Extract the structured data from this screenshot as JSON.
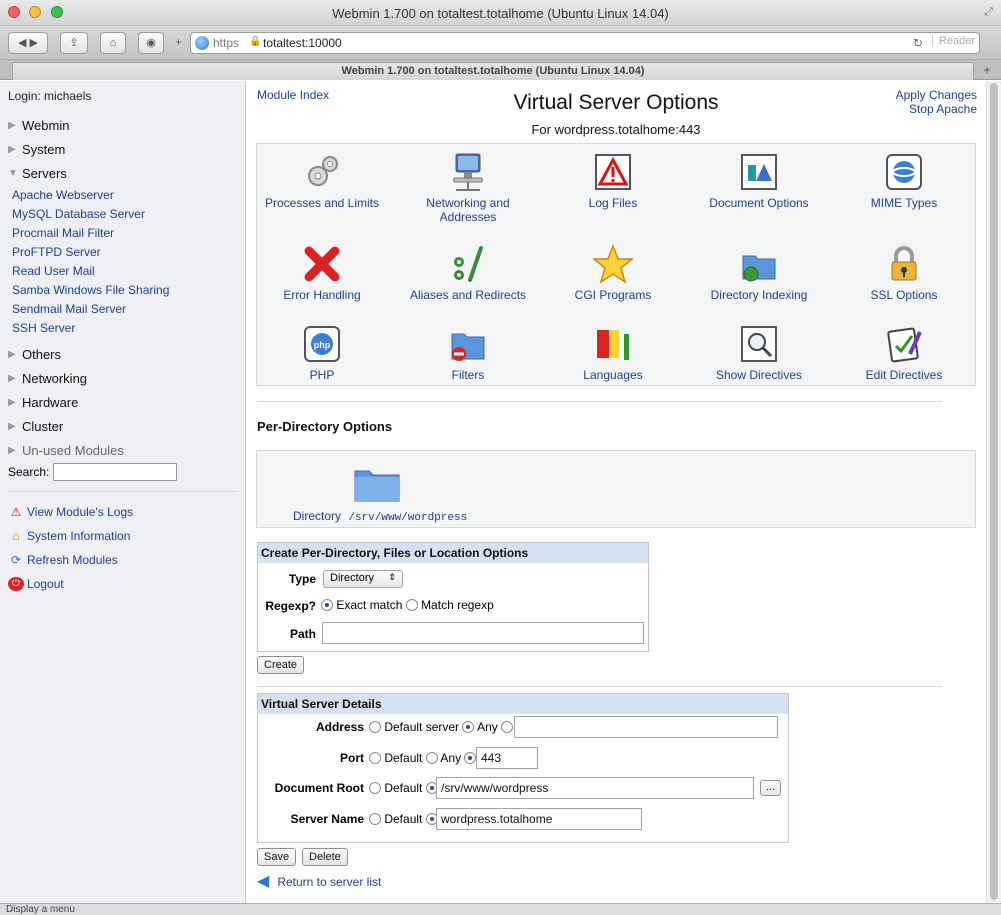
{
  "window": {
    "title": "Webmin 1.700 on totaltest.totalhome (Ubuntu Linux 14.04)",
    "tab_title": "Webmin 1.700 on totaltest.totalhome (Ubuntu Linux 14.04)"
  },
  "browser": {
    "url_scheme": "https",
    "url_host": "totaltest:10000",
    "reader": "Reader"
  },
  "sidebar": {
    "login": "Login: michaels",
    "categories": {
      "webmin": "Webmin",
      "system": "System",
      "servers": "Servers",
      "others": "Others",
      "networking": "Networking",
      "hardware": "Hardware",
      "cluster": "Cluster",
      "unused": "Un-used Modules"
    },
    "server_modules": [
      "Apache Webserver",
      "MySQL Database Server",
      "Procmail Mail Filter",
      "ProFTPD Server",
      "Read User Mail",
      "Samba Windows File Sharing",
      "Sendmail Mail Server",
      "SSH Server"
    ],
    "search_label": "Search:",
    "links": {
      "logs": "View Module's Logs",
      "sysinfo": "System Information",
      "refresh": "Refresh Modules",
      "logout": "Logout"
    }
  },
  "header": {
    "module_index": "Module Index",
    "apply_changes": "Apply Changes",
    "stop_apache": "Stop Apache",
    "title": "Virtual Server Options",
    "subtitle": "For wordpress.totalhome:443"
  },
  "icons": [
    {
      "label": "Processes and Limits",
      "icon": "gears-icon"
    },
    {
      "label": "Networking and Addresses",
      "icon": "network-computer-icon"
    },
    {
      "label": "Log Files",
      "icon": "warning-log-icon"
    },
    {
      "label": "Document Options",
      "icon": "document-icon"
    },
    {
      "label": "MIME Types",
      "icon": "mime-icon"
    },
    {
      "label": "Error Handling",
      "icon": "error-x-icon"
    },
    {
      "label": "Aliases and Redirects",
      "icon": "alias-redirect-icon"
    },
    {
      "label": "CGI Programs",
      "icon": "star-icon"
    },
    {
      "label": "Directory Indexing",
      "icon": "folder-globe-icon"
    },
    {
      "label": "SSL Options",
      "icon": "padlock-icon"
    },
    {
      "label": "PHP",
      "icon": "php-icon"
    },
    {
      "label": "Filters",
      "icon": "folder-no-entry-icon"
    },
    {
      "label": "Languages",
      "icon": "flags-icon"
    },
    {
      "label": "Show Directives",
      "icon": "magnifier-icon"
    },
    {
      "label": "Edit Directives",
      "icon": "edit-pencil-icon"
    }
  ],
  "per_directory": {
    "section_title": "Per-Directory Options",
    "directory_label": "Directory",
    "directory_path": "/srv/www/wordpress"
  },
  "create_form": {
    "heading": "Create Per-Directory, Files or Location Options",
    "type_label": "Type",
    "type_value": "Directory",
    "regexp_label": "Regexp?",
    "exact_match": "Exact match",
    "match_regexp": "Match regexp",
    "path_label": "Path",
    "path_value": "",
    "create_button": "Create"
  },
  "details_form": {
    "heading": "Virtual Server Details",
    "address_label": "Address",
    "default_server": "Default server",
    "any": "Any",
    "address_value": "",
    "port_label": "Port",
    "default": "Default",
    "port_value": "443",
    "docroot_label": "Document Root",
    "docroot_value": "/srv/www/wordpress",
    "browse_button": "...",
    "servername_label": "Server Name",
    "servername_value": "wordpress.totalhome",
    "save_button": "Save",
    "delete_button": "Delete"
  },
  "return_link": "Return to server list",
  "status": "Display a menu",
  "colors": {
    "link": "#1f3f8f",
    "form_header": "#d6e2f1",
    "sidebar_bg": "#eef0f3"
  }
}
